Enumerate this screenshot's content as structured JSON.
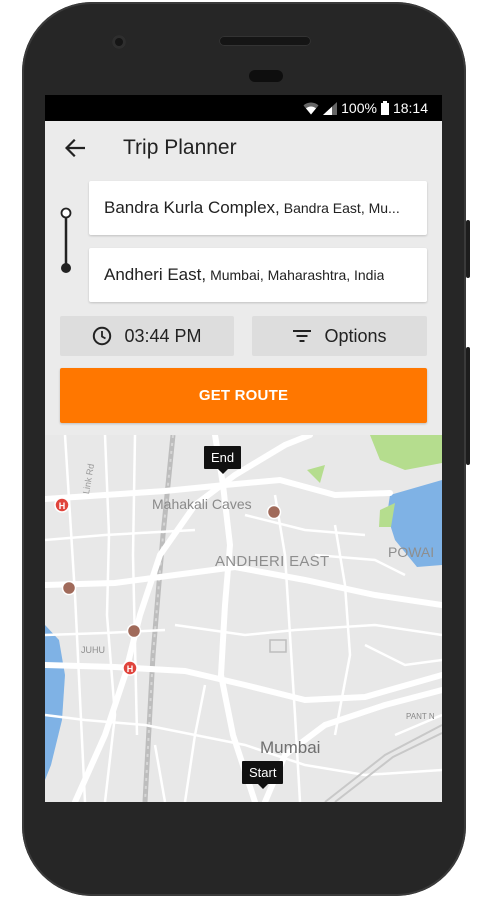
{
  "status_bar": {
    "battery": "100%",
    "time": "18:14"
  },
  "app_bar": {
    "title": "Trip Planner"
  },
  "origin": {
    "main": "Bandra Kurla Complex,",
    "sub": "Bandra East, Mu..."
  },
  "destination": {
    "main": "Andheri East,",
    "sub": "Mumbai, Maharashtra, India"
  },
  "time_button": {
    "label": "03:44 PM"
  },
  "options_button": {
    "label": "Options"
  },
  "get_route_button": {
    "label": "GET ROUTE"
  },
  "map": {
    "labels": {
      "mahakali_caves": "Mahakali Caves",
      "andheri_east": "ANDHERI EAST",
      "powai": "POWAI",
      "mumbai": "Mumbai",
      "juhu": "JUHU",
      "pant_nagar": "PANT N",
      "link_rd": "Link Rd"
    },
    "end_marker": "End",
    "start_marker": "Start"
  },
  "colors": {
    "accent": "#ff7700",
    "map_land": "#e8e8e8",
    "map_water": "#7fb2e5",
    "map_park": "#b5dd8e",
    "hospital": "#e0443c",
    "poi": "#a06a5a"
  }
}
